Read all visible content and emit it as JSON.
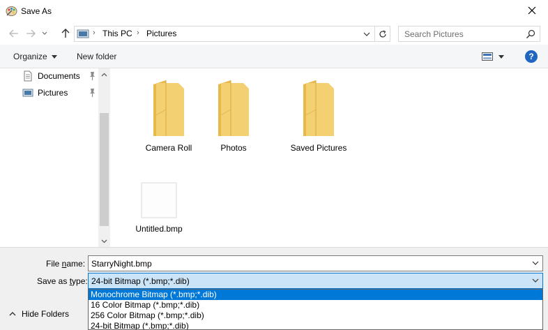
{
  "window": {
    "title": "Save As",
    "icon": "paint-icon"
  },
  "address": {
    "crumbs": [
      "This PC",
      "Pictures"
    ],
    "search_placeholder": "Search Pictures"
  },
  "toolbar": {
    "organize": "Organize",
    "new_folder": "New folder",
    "help": "?"
  },
  "navpane": {
    "items": [
      {
        "label": "Documents",
        "icon": "documents-icon"
      },
      {
        "label": "Pictures",
        "icon": "pictures-icon"
      }
    ]
  },
  "content": {
    "items": [
      {
        "label": "Camera Roll",
        "kind": "folder"
      },
      {
        "label": "Photos",
        "kind": "folder"
      },
      {
        "label": "Saved Pictures",
        "kind": "folder"
      },
      {
        "label": "Untitled.bmp",
        "kind": "file"
      }
    ]
  },
  "form": {
    "file_name_label_pre": "File ",
    "file_name_label_key": "n",
    "file_name_label_post": "ame:",
    "file_name_value": "StarryNight.bmp",
    "save_type_label_pre": "Save as ",
    "save_type_label_key": "t",
    "save_type_label_post": "ype:",
    "save_type_value": "24-bit Bitmap (*.bmp;*.dib)",
    "type_options": [
      "Monochrome Bitmap (*.bmp;*.dib)",
      "16 Color Bitmap (*.bmp;*.dib)",
      "256 Color Bitmap (*.bmp;*.dib)",
      "24-bit Bitmap (*.bmp;*.dib)"
    ],
    "selected_option_index": 0
  },
  "footer": {
    "hide_folders": "Hide Folders"
  },
  "colors": {
    "accent": "#0078d7",
    "folder": "#f3d173",
    "folder_dark": "#e6b94a",
    "help": "#1f66c2"
  }
}
